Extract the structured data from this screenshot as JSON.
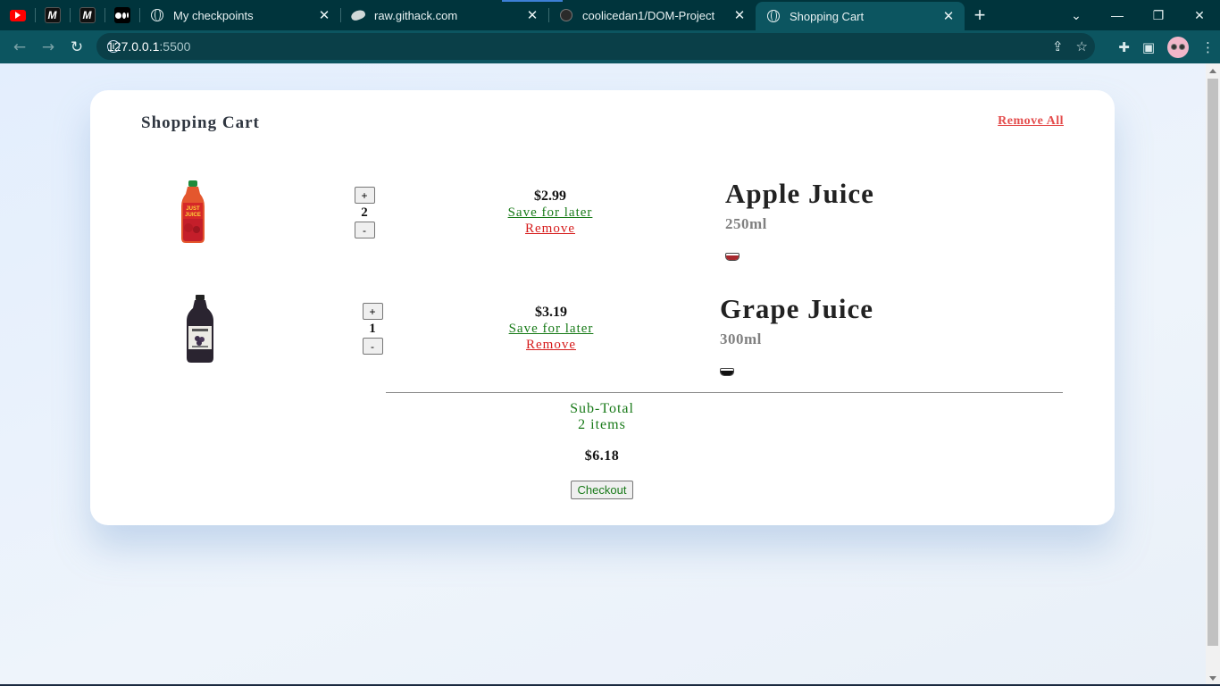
{
  "browser": {
    "tabs": [
      {
        "title": "My checkpoints",
        "icon": "globe-icon",
        "active": false
      },
      {
        "title": "raw.githack.com",
        "icon": "githack-icon",
        "active": false
      },
      {
        "title": "coolicedan1/DOM-Project",
        "icon": "github-icon",
        "active": false
      },
      {
        "title": "Shopping Cart",
        "icon": "globe-icon",
        "active": true
      }
    ],
    "pinned_tabs": [
      "youtube-icon",
      "m-icon",
      "m-icon",
      "medium-icon"
    ],
    "url_host": "127.0.0.1",
    "url_port": ":5500",
    "colors": {
      "frame": "#00343c",
      "toolbar": "#0c5560"
    }
  },
  "cart": {
    "title": "Shopping Cart",
    "remove_all": "Remove All",
    "items": [
      {
        "name": "Apple Juice",
        "volume": "250ml",
        "price": "$2.99",
        "quantity": "2",
        "save_label": "Save for later",
        "remove_label": "Remove",
        "swatch_color": "#a8282e"
      },
      {
        "name": "Grape Juice",
        "volume": "300ml",
        "price": "$3.19",
        "quantity": "1",
        "save_label": "Save for later",
        "remove_label": "Remove",
        "swatch_color": "#111111"
      }
    ],
    "plus_label": "+",
    "minus_label": "-",
    "summary": {
      "subtotal_label": "Sub-Total",
      "items_count": "2 items",
      "total": "$6.18",
      "checkout_label": "Checkout"
    },
    "colors": {
      "accent_green": "#197a19",
      "remove_red": "#d61c1c",
      "remove_all_red": "#e44c4c"
    }
  },
  "apple_bottle_label": "JUST JUICE"
}
